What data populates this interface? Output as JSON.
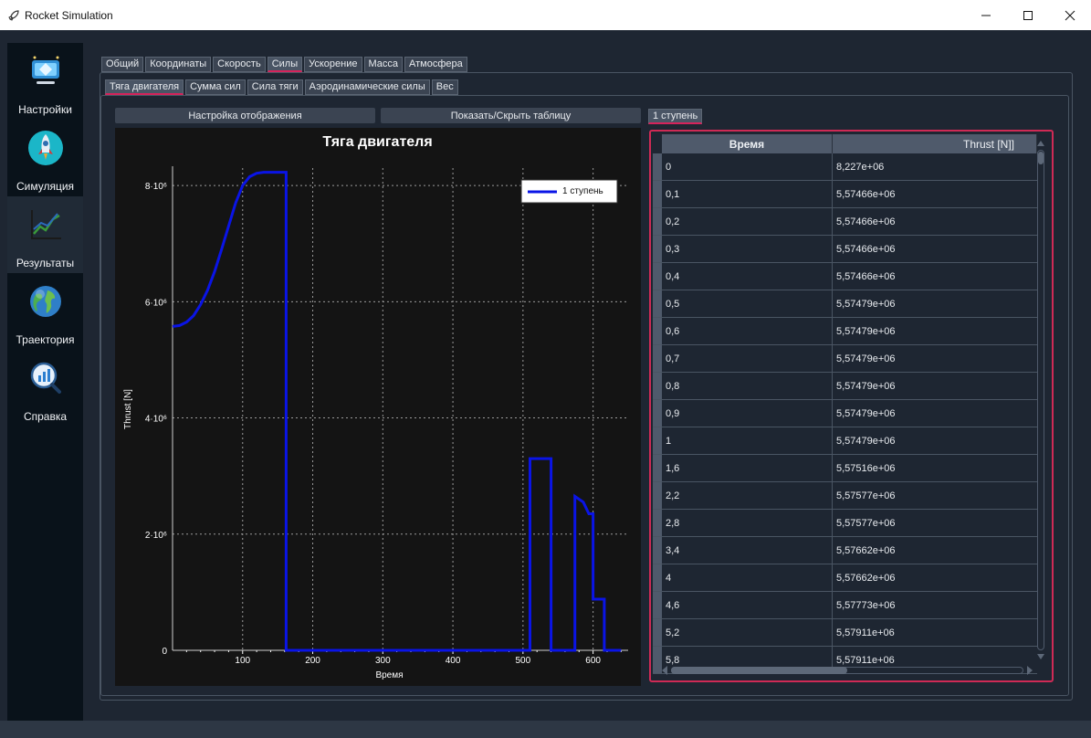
{
  "window": {
    "title": "Rocket Simulation"
  },
  "sidebar": {
    "items": [
      {
        "label": "Настройки",
        "icon": "settings-monitor-icon"
      },
      {
        "label": "Симуляция",
        "icon": "rocket-icon"
      },
      {
        "label": "Результаты",
        "icon": "chart-trend-icon",
        "active": true
      },
      {
        "label": "Траектория",
        "icon": "globe-icon"
      },
      {
        "label": "Справка",
        "icon": "magnifier-chart-icon"
      }
    ]
  },
  "tabs_main": [
    "Общий",
    "Координаты",
    "Скорость",
    "Силы",
    "Ускорение",
    "Масса",
    "Атмосфера"
  ],
  "tabs_main_active": 3,
  "tabs_sub": [
    "Тяга двигателя",
    "Сумма сил",
    "Сила тяги",
    "Аэродинамические силы",
    "Вес"
  ],
  "tabs_sub_active": 0,
  "buttons": {
    "display_settings": "Настройка отображения",
    "toggle_table": "Показать/Скрыть таблицу"
  },
  "stage_tab": "1 ступень",
  "accent_color": "#d6235b",
  "series_color": "#0a14e6",
  "chart_data": {
    "type": "line",
    "title": "Тяга двигателя",
    "xlabel": "Время",
    "ylabel": "Thrust [N]",
    "xlim": [
      0,
      650
    ],
    "ylim": [
      0,
      8300000
    ],
    "xticks": [
      100,
      200,
      300,
      400,
      500,
      600
    ],
    "yticks": [
      0,
      2000000,
      4000000,
      6000000,
      8000000
    ],
    "ytick_labels": [
      "0",
      "2·10⁶",
      "4·10⁶",
      "6·10⁶",
      "8·10⁶"
    ],
    "grid": true,
    "legend_position": "top-right",
    "series": [
      {
        "name": "1 ступень",
        "x": [
          0,
          10,
          20,
          30,
          40,
          50,
          60,
          70,
          80,
          90,
          100,
          110,
          120,
          130,
          140,
          150,
          162,
          162,
          163,
          510,
          510,
          540,
          540,
          574,
          574,
          586,
          594,
          600,
          600,
          616,
          616,
          640
        ],
        "y": [
          5574660,
          5590000,
          5650000,
          5760000,
          5950000,
          6200000,
          6520000,
          6900000,
          7300000,
          7700000,
          8000000,
          8150000,
          8210000,
          8227000,
          8227000,
          8227000,
          8227000,
          0,
          0,
          0,
          3300000,
          3300000,
          0,
          0,
          2650000,
          2550000,
          2350000,
          2350000,
          880000,
          880000,
          0,
          0
        ]
      }
    ]
  },
  "table": {
    "headers": [
      "Время",
      "Thrust [N]]"
    ],
    "rows": [
      [
        "0",
        "8,227e+06"
      ],
      [
        "0,1",
        "5,57466e+06"
      ],
      [
        "0,2",
        "5,57466e+06"
      ],
      [
        "0,3",
        "5,57466e+06"
      ],
      [
        "0,4",
        "5,57466e+06"
      ],
      [
        "0,5",
        "5,57479e+06"
      ],
      [
        "0,6",
        "5,57479e+06"
      ],
      [
        "0,7",
        "5,57479e+06"
      ],
      [
        "0,8",
        "5,57479e+06"
      ],
      [
        "0,9",
        "5,57479e+06"
      ],
      [
        "1",
        "5,57479e+06"
      ],
      [
        "1,6",
        "5,57516e+06"
      ],
      [
        "2,2",
        "5,57577e+06"
      ],
      [
        "2,8",
        "5,57577e+06"
      ],
      [
        "3,4",
        "5,57662e+06"
      ],
      [
        "4",
        "5,57662e+06"
      ],
      [
        "4,6",
        "5,57773e+06"
      ],
      [
        "5,2",
        "5,57911e+06"
      ],
      [
        "5,8",
        "5,57911e+06"
      ]
    ]
  }
}
